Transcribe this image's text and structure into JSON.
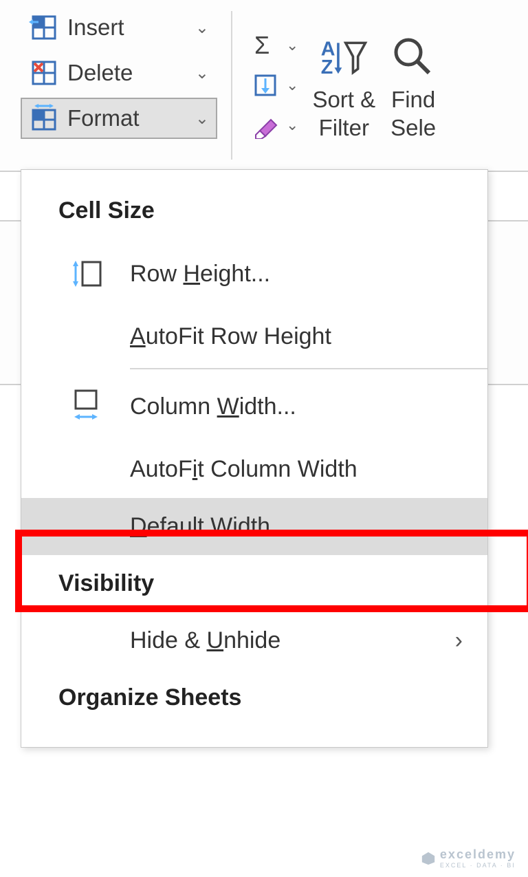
{
  "ribbon": {
    "cells": {
      "insert": "Insert",
      "delete": "Delete",
      "format": "Format"
    },
    "editing": {
      "sortFilter": "Sort &\nFilter",
      "findSelect": "Find\nSele"
    }
  },
  "menu": {
    "headings": {
      "cellSize": "Cell Size",
      "visibility": "Visibility",
      "organizeSheets": "Organize Sheets"
    },
    "items": {
      "rowHeight_pre": "Row ",
      "rowHeight_u": "H",
      "rowHeight_post": "eight...",
      "autofitRow_u": "A",
      "autofitRow_post": "utoFit Row Height",
      "colWidth_pre": "Column ",
      "colWidth_u": "W",
      "colWidth_post": "idth...",
      "autofitCol_pre": "AutoF",
      "autofitCol_u": "i",
      "autofitCol_post": "t Column Width",
      "defaultWidth_u": "D",
      "defaultWidth_post": "efault Width...",
      "hideUnhide_pre": "Hide & ",
      "hideUnhide_u": "U",
      "hideUnhide_post": "nhide"
    }
  },
  "watermark": {
    "brand": "exceldemy",
    "tag": "EXCEL · DATA · BI"
  }
}
